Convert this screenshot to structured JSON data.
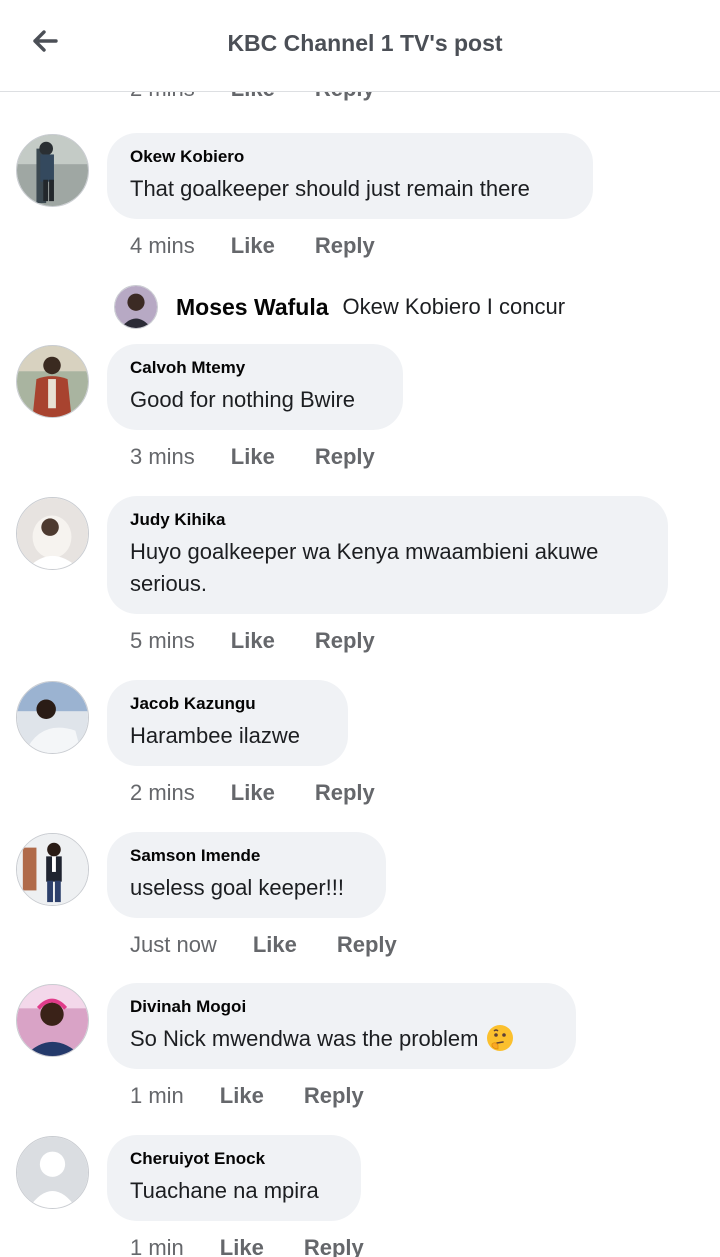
{
  "header": {
    "title": "KBC Channel 1 TV's post",
    "back_icon": "arrow-left-icon"
  },
  "partial_row": {
    "time": "2 mins",
    "like": "Like",
    "reply": "Reply"
  },
  "comments": [
    {
      "name": "Okew Kobiero",
      "text": "That goalkeeper should just remain there",
      "time": "4 mins",
      "like": "Like",
      "reply": "Reply"
    },
    {
      "name": "Calvoh Mtemy",
      "text": "Good for nothing Bwire",
      "time": "3 mins",
      "like": "Like",
      "reply": "Reply"
    },
    {
      "name": "Judy Kihika",
      "text": "Huyo goalkeeper  wa Kenya mwaambieni akuwe serious.",
      "time": "5 mins",
      "like": "Like",
      "reply": "Reply"
    },
    {
      "name": "Jacob Kazungu",
      "text": "Harambee  ilazwe",
      "time": "2 mins",
      "like": "Like",
      "reply": "Reply"
    },
    {
      "name": "Samson Imende",
      "text": "useless goal keeper!!!",
      "time": "Just now",
      "like": "Like",
      "reply": "Reply"
    },
    {
      "name": "Divinah Mogoi",
      "text": "So Nick mwendwa was the problem",
      "emoji": "thinking-face-icon",
      "time": "1 min",
      "like": "Like",
      "reply": "Reply"
    },
    {
      "name": "Cheruiyot Enock",
      "text": "Tuachane na mpira",
      "time": "1 min",
      "like": "Like",
      "reply": "Reply"
    }
  ],
  "reply": {
    "name": "Moses Wafula",
    "text": "Okew Kobiero I concur"
  }
}
